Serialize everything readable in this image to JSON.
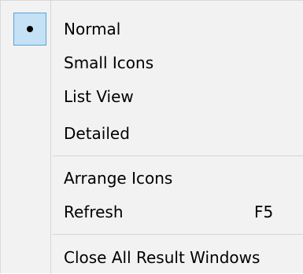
{
  "menu": {
    "items": [
      {
        "label": "Normal",
        "checked": true
      },
      {
        "label": "Small Icons"
      },
      {
        "label": "List View"
      },
      {
        "label": "Detailed"
      },
      {
        "label": "Arrange Icons"
      },
      {
        "label": "Refresh",
        "shortcut": "F5"
      },
      {
        "label": "Close All Result Windows"
      }
    ]
  },
  "colors": {
    "menu_background": "#f2f2f2",
    "checked_highlight": "#c4e1f5",
    "checked_border": "#5aa3d6",
    "separator": "#d6d6d6"
  }
}
